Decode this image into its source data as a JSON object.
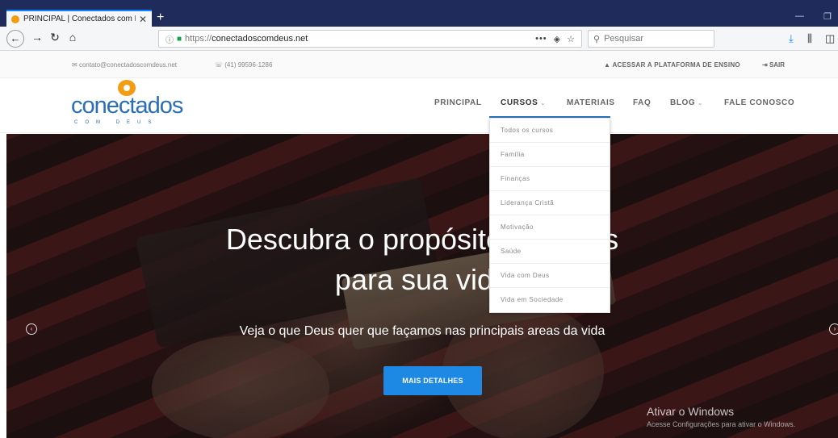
{
  "browser": {
    "tab_title": "PRINCIPAL | Conectados com D",
    "tab_close": "✕",
    "new_tab": "+",
    "url_proto": "https://",
    "url_host": "conectadoscomdeus.net",
    "url_menu": "•••",
    "search_placeholder": "Pesquisar",
    "window_minimize": "—",
    "window_restore": "❐"
  },
  "topbar": {
    "email": "contato@conectadoscomdeus.net",
    "phone": "(41) 99596-1286",
    "platform_link": "ACESSAR A PLATAFORMA DE ENSINO",
    "logout": "SAIR"
  },
  "logo": {
    "word": "conectados",
    "sub": "COM DEUS"
  },
  "menu": {
    "items": [
      {
        "label": "PRINCIPAL"
      },
      {
        "label": "CURSOS"
      },
      {
        "label": "MATERIAIS"
      },
      {
        "label": "FAQ"
      },
      {
        "label": "BLOG"
      },
      {
        "label": "FALE CONOSCO"
      }
    ]
  },
  "dropdown": {
    "items": [
      {
        "label": "Todos os cursos"
      },
      {
        "label": "Família"
      },
      {
        "label": "Finanças"
      },
      {
        "label": "Liderança Cristã"
      },
      {
        "label": "Motivação"
      },
      {
        "label": "Saúde"
      },
      {
        "label": "Vida com Deus"
      },
      {
        "label": "Vida em Sociedade"
      }
    ]
  },
  "hero": {
    "line1": "Descubra o propósito de Deus",
    "line2": "para sua vida",
    "subtitle": "Veja o que Deus quer que façamos nas principais areas da vida",
    "cta": "MAIS DETALHES"
  },
  "watermark": {
    "title": "Ativar o Windows",
    "text": "Acesse Configurações para ativar o Windows."
  },
  "colors": {
    "brand": "#2a6eb8",
    "accent": "#f39c12",
    "cta": "#1e88e5",
    "tabbar": "#1f2b5a"
  }
}
